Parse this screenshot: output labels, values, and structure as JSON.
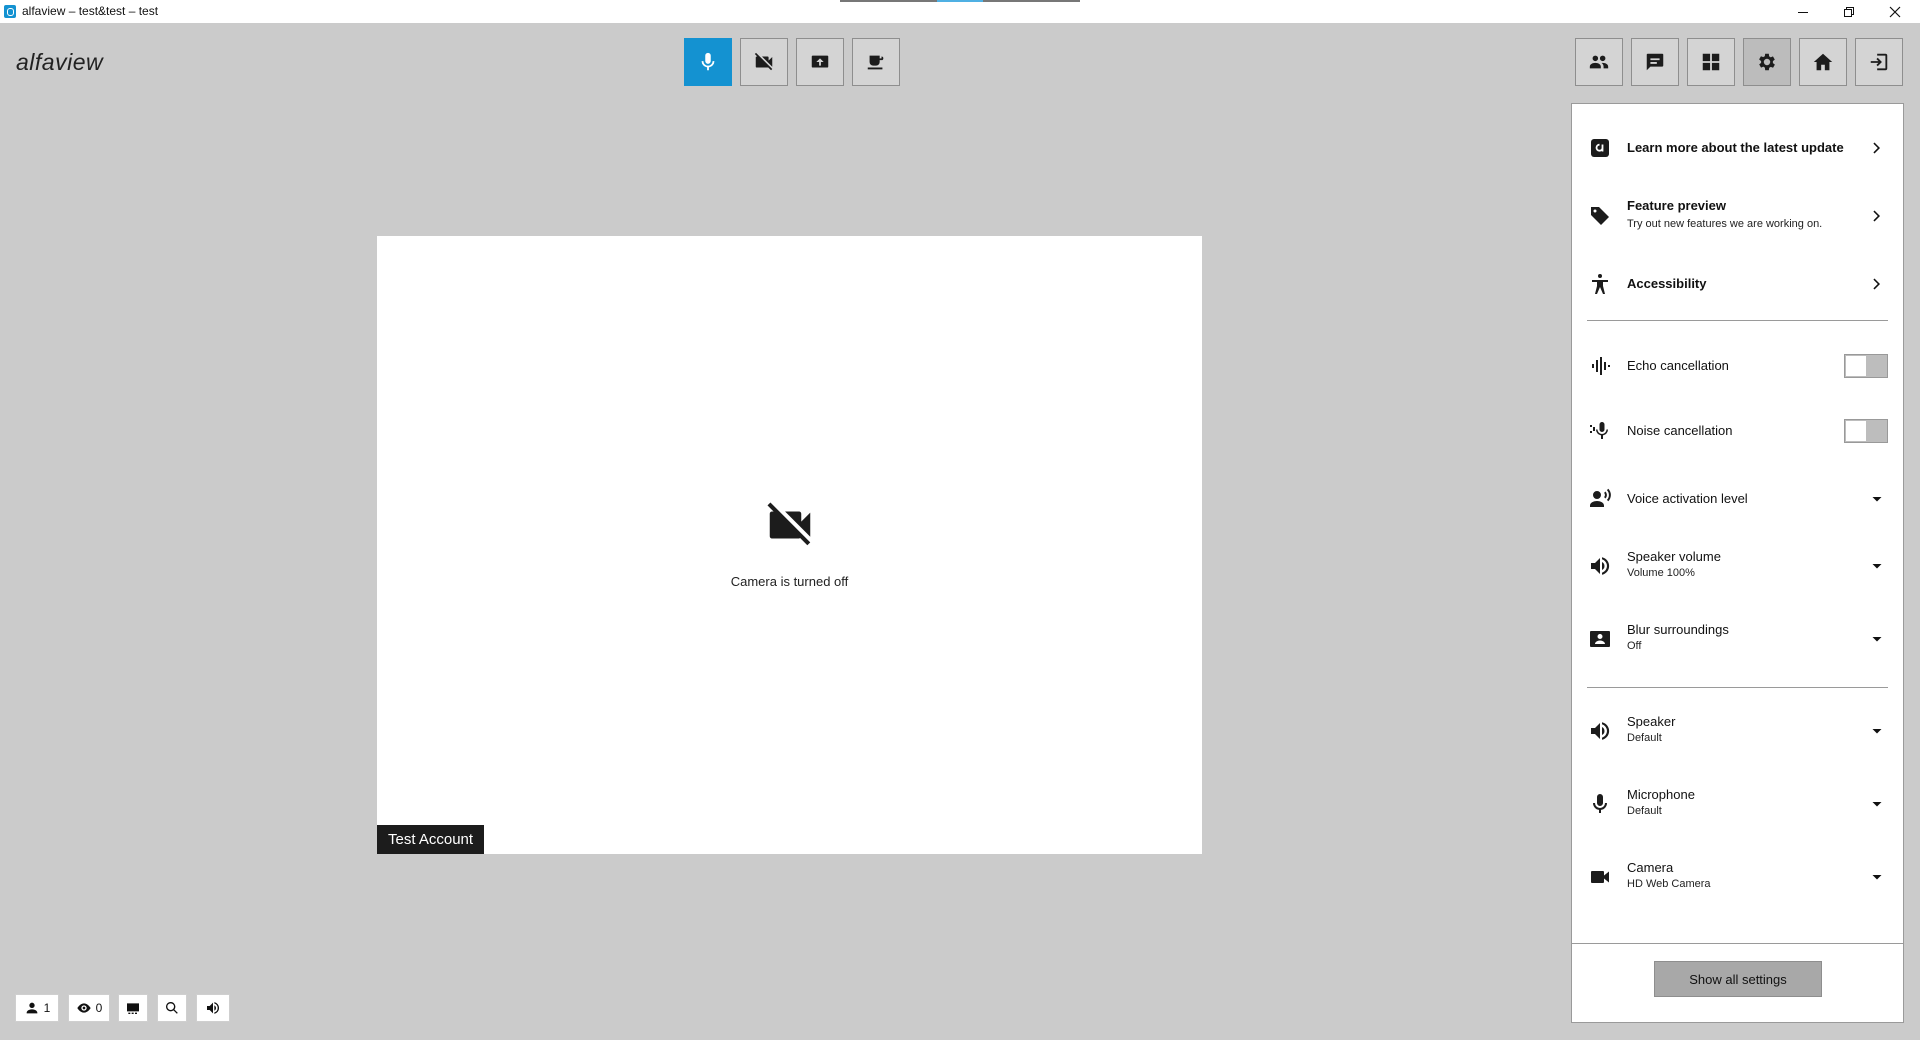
{
  "window": {
    "title": "alfaview – test&test – test",
    "controls": [
      "minimize",
      "restore",
      "close"
    ]
  },
  "app": {
    "logo": "alfaview"
  },
  "toolbar": {
    "left": [
      {
        "name": "microphone",
        "icon": "microphone-icon",
        "state": "active"
      },
      {
        "name": "camera",
        "icon": "camera-off-icon"
      },
      {
        "name": "share-screen",
        "icon": "screen-share-icon"
      },
      {
        "name": "break",
        "icon": "coffee-icon"
      }
    ],
    "right": [
      {
        "name": "participants",
        "icon": "people-icon"
      },
      {
        "name": "chat",
        "icon": "chat-icon"
      },
      {
        "name": "layout",
        "icon": "grid-icon"
      },
      {
        "name": "settings",
        "icon": "gear-icon",
        "state": "pressed"
      },
      {
        "name": "home",
        "icon": "home-icon"
      },
      {
        "name": "leave",
        "icon": "exit-icon"
      }
    ]
  },
  "video": {
    "camera_off_label": "Camera is turned off",
    "participant_name": "Test Account"
  },
  "status_bar": {
    "participants_count": "1",
    "viewers_count": "0"
  },
  "settings_panel": {
    "items": [
      {
        "label": "Learn more about the latest update",
        "icon": "alfaview-icon",
        "type": "link"
      },
      {
        "label": "Feature preview",
        "sublabel": "Try out new features we are working on.",
        "icon": "tag-icon",
        "type": "link"
      },
      {
        "label": "Accessibility",
        "icon": "accessibility-icon",
        "type": "link"
      },
      {
        "label": "Echo cancellation",
        "icon": "echo-icon",
        "type": "toggle",
        "value": "off"
      },
      {
        "label": "Noise cancellation",
        "icon": "noise-mic-icon",
        "type": "toggle",
        "value": "off"
      },
      {
        "label": "Voice activation level",
        "icon": "voice-level-icon",
        "type": "dropdown"
      },
      {
        "label": "Speaker volume",
        "sublabel": "Volume 100%",
        "icon": "speaker-icon",
        "type": "dropdown"
      },
      {
        "label": "Blur surroundings",
        "sublabel": "Off",
        "icon": "blur-person-icon",
        "type": "dropdown"
      },
      {
        "label": "Speaker",
        "sublabel": "Default",
        "icon": "speaker-icon",
        "type": "dropdown"
      },
      {
        "label": "Microphone",
        "sublabel": "Default",
        "icon": "microphone-icon",
        "type": "dropdown"
      },
      {
        "label": "Camera",
        "sublabel": "HD Web Camera",
        "icon": "camera-icon",
        "type": "dropdown"
      }
    ],
    "show_all_label": "Show all settings"
  },
  "colors": {
    "accent": "#1492d1",
    "background": "#cbcbcb",
    "name_tag": "#1c1c1c"
  }
}
